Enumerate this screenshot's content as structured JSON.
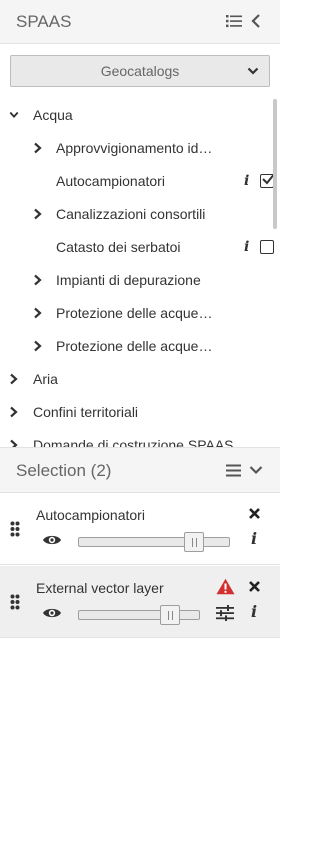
{
  "header": {
    "title": "SPAAS",
    "list_icon": "list-icon",
    "back_icon": "chevron-left-icon"
  },
  "catalog_select": {
    "selected": "Geocatalogs"
  },
  "tree": {
    "nodes": [
      {
        "label": "Acqua",
        "expanded": true,
        "level": 0,
        "has_children": true
      },
      {
        "label": "Approvvigionamento idri…",
        "level": 1,
        "has_children": true
      },
      {
        "label": "Autocampionatori",
        "level": 1,
        "has_children": false,
        "checked": true
      },
      {
        "label": "Canalizzazioni consortili",
        "level": 1,
        "has_children": true
      },
      {
        "label": "Catasto dei serbatoi",
        "level": 1,
        "has_children": false,
        "checked": false
      },
      {
        "label": "Impianti di depurazione",
        "level": 1,
        "has_children": true
      },
      {
        "label": "Protezione delle acque s…",
        "level": 1,
        "has_children": true
      },
      {
        "label": "Protezione delle acque s…",
        "level": 1,
        "has_children": true
      },
      {
        "label": "Aria",
        "level": 0,
        "has_children": true
      },
      {
        "label": "Confini territoriali",
        "level": 0,
        "has_children": true
      },
      {
        "label": "Domande di costruzione SPAAS",
        "level": 0,
        "has_children": true
      }
    ],
    "info_glyph": "i"
  },
  "selection": {
    "title": "Selection (2)",
    "layers": [
      {
        "name": "Autocampionatori",
        "opacity": 0.8,
        "warning": false
      },
      {
        "name": "External vector layer",
        "opacity": 0.75,
        "warning": true
      }
    ],
    "info_glyph": "i"
  },
  "colors": {
    "warning": "#d32f2f",
    "icon": "#333333",
    "header_bg": "#f5f5f5"
  }
}
